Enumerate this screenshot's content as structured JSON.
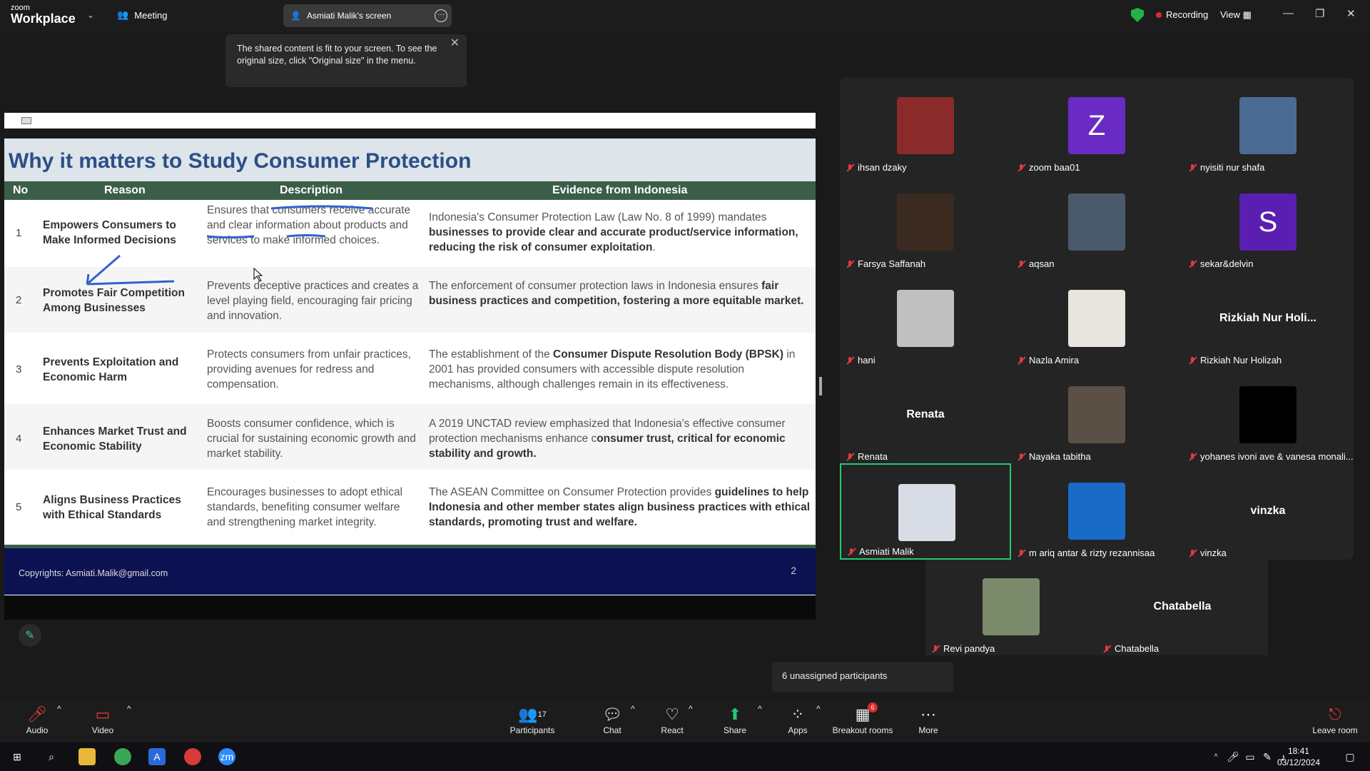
{
  "titlebar": {
    "logo_line1": "zoom",
    "logo_line2": "Workplace",
    "meeting_label": "Meeting",
    "screen_label": "Asmiati Malik's screen",
    "recording_label": "Recording",
    "view_label": "View"
  },
  "tooltip": {
    "text": "The shared content is fit to your screen. To see the original size, click \"Original size\" in the menu."
  },
  "slide": {
    "title": "Why it matters to Study Consumer Protection",
    "headers": {
      "no": "No",
      "reason": "Reason",
      "description": "Description",
      "evidence": "Evidence from Indonesia"
    },
    "rows": [
      {
        "no": "1",
        "reason": "Empowers Consumers to Make Informed Decisions",
        "description": "Ensures that consumers receive accurate and clear information about products and services to make informed choices.",
        "evidence_plain": "Indonesia's Consumer Protection Law (Law No. 8 of 1999) mandates ",
        "evidence_bold": "businesses to provide clear and accurate product/service information, reducing the risk of consumer exploitation",
        "evidence_tail": "."
      },
      {
        "no": "2",
        "reason": "Promotes Fair Competition Among Businesses",
        "description": "Prevents deceptive practices and creates a level playing field, encouraging fair pricing and innovation.",
        "evidence_plain": "The enforcement of consumer protection laws in Indonesia ensures ",
        "evidence_bold": "fair business practices and competition, fostering a more equitable market.",
        "evidence_tail": ""
      },
      {
        "no": "3",
        "reason": "Prevents Exploitation and Economic Harm",
        "description": "Protects consumers from unfair practices, providing avenues for redress and compensation.",
        "evidence_plain": "The establishment of the ",
        "evidence_bold": "Consumer Dispute Resolution Body (BPSK)",
        "evidence_tail": " in 2001 has provided consumers with accessible dispute resolution mechanisms, although challenges remain in its effectiveness."
      },
      {
        "no": "4",
        "reason": "Enhances Market Trust and Economic Stability",
        "description": "Boosts consumer confidence, which is crucial for sustaining economic growth and market stability.",
        "evidence_plain": "A 2019 UNCTAD review emphasized that Indonesia's effective consumer protection mechanisms enhance c",
        "evidence_bold": "onsumer trust, critical for economic stability and growth.",
        "evidence_tail": ""
      },
      {
        "no": "5",
        "reason": "Aligns Business Practices with Ethical Standards",
        "description": "Encourages businesses to adopt ethical standards, benefiting consumer welfare and strengthening market integrity.",
        "evidence_plain": "The ASEAN Committee on Consumer Protection provides ",
        "evidence_bold": "guidelines to help Indonesia and other member states align business practices with ethical standards, promoting trust and welfare.",
        "evidence_tail": ""
      }
    ],
    "copyright": "Copyrights: Asmiati.Malik@gmail.com",
    "page_number": "2"
  },
  "participants": [
    {
      "name": "ihsan dzaky",
      "avatar": "photo",
      "color": "#8a2a2a"
    },
    {
      "name": "zoom baa01",
      "avatar": "letter",
      "letter": "Z",
      "color": "#6a2bc4"
    },
    {
      "name": "nyisiti nur shafa",
      "avatar": "photo",
      "color": "#4a6a94"
    },
    {
      "name": "Farsya Saffanah",
      "avatar": "photo",
      "color": "#3a2a20"
    },
    {
      "name": "aqsan",
      "avatar": "photo",
      "color": "#4a5a6a"
    },
    {
      "name": "sekar&delvin",
      "avatar": "letter",
      "letter": "S",
      "color": "#5a1fb0"
    },
    {
      "name": "hani",
      "avatar": "photo",
      "color": "#c0c0c0"
    },
    {
      "name": "Nazla Amira",
      "avatar": "photo",
      "color": "#e8e4de"
    },
    {
      "name": "Rizkiah Nur Holizah",
      "avatar": "text",
      "display": "Rizkiah Nur Holi..."
    },
    {
      "name": "Renata",
      "avatar": "text",
      "display": "Renata"
    },
    {
      "name": "Nayaka tabitha",
      "avatar": "photo",
      "color": "#5a5046"
    },
    {
      "name": "yohanes ivoni ave & vanesa monali...",
      "avatar": "photo",
      "color": "#000000"
    },
    {
      "name": "Asmiati Malik",
      "avatar": "photo",
      "color": "#d8dce4",
      "active": true
    },
    {
      "name": "m ariq antar & rizty rezannisaa",
      "avatar": "photo",
      "color": "#1a6ac8"
    },
    {
      "name": "vinzka",
      "avatar": "text",
      "display": "vinzka"
    },
    {
      "name": "Revi pandya",
      "avatar": "photo",
      "color": "#7a8a6a"
    },
    {
      "name": "Chatabella",
      "avatar": "text",
      "display": "Chatabella"
    }
  ],
  "unassigned": "6 unassigned participants",
  "toolbar": {
    "audio": "Audio",
    "video": "Video",
    "participants": "Participants",
    "participants_count": "17",
    "chat": "Chat",
    "react": "React",
    "share": "Share",
    "apps": "Apps",
    "breakout": "Breakout rooms",
    "breakout_badge": "6",
    "more": "More",
    "leave": "Leave room"
  },
  "taskbar": {
    "time": "18:41",
    "date": "03/12/2024"
  },
  "colors": {
    "accent_green": "#28c76f",
    "slide_title": "#2b4f86",
    "table_header": "#3b5e49",
    "footer": "#0c1152",
    "record_red": "#e02a2a"
  }
}
